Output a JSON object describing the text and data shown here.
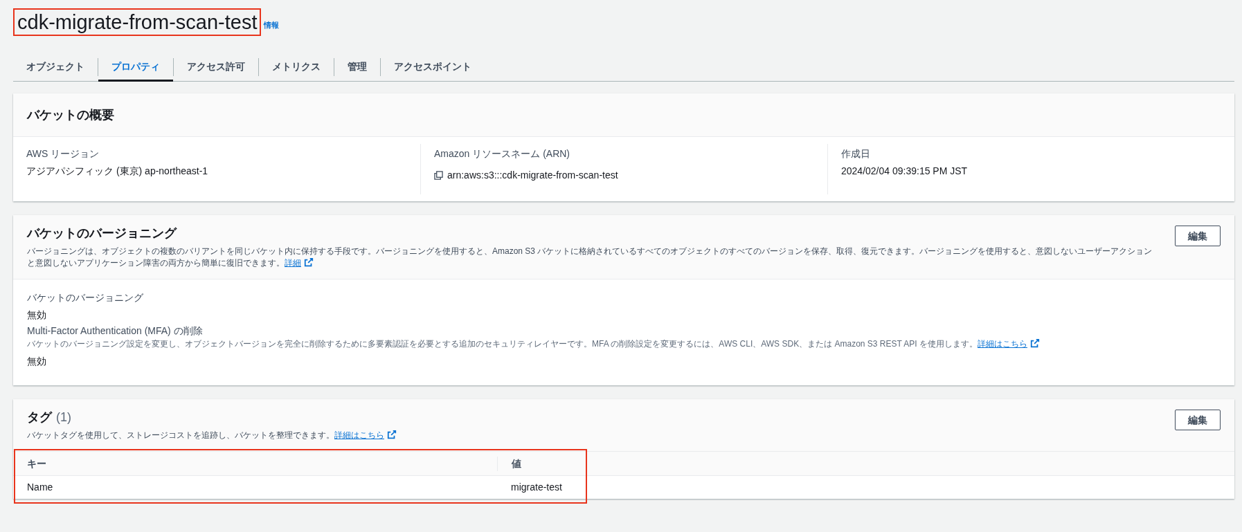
{
  "header": {
    "title": "cdk-migrate-from-scan-test",
    "info_link": "情報",
    "highlighted": true
  },
  "tabs": [
    {
      "label": "オブジェクト",
      "selected": false
    },
    {
      "label": "プロパティ",
      "selected": true
    },
    {
      "label": "アクセス許可",
      "selected": false
    },
    {
      "label": "メトリクス",
      "selected": false
    },
    {
      "label": "管理",
      "selected": false
    },
    {
      "label": "アクセスポイント",
      "selected": false
    }
  ],
  "overview": {
    "title": "バケットの概要",
    "fields": [
      {
        "label": "AWS リージョン",
        "value": "アジアパシフィック (東京) ap-northeast-1",
        "copyable": false
      },
      {
        "label": "Amazon リソースネーム (ARN)",
        "value": "arn:aws:s3:::cdk-migrate-from-scan-test",
        "copyable": true
      },
      {
        "label": "作成日",
        "value": "2024/02/04 09:39:15 PM JST",
        "copyable": false
      }
    ]
  },
  "versioning": {
    "title": "バケットのバージョニング",
    "description": "バージョニングは、オブジェクトの複数のバリアントを同じバケット内に保持する手段です。バージョニングを使用すると、Amazon S3 バケットに格納されているすべてのオブジェクトのすべてのバージョンを保存、取得、復元できます。バージョニングを使用すると、意図しないユーザーアクションと意図しないアプリケーション障害の両方から簡単に復旧できます。",
    "link": "詳細",
    "edit_button": "編集",
    "fields": [
      {
        "label": "バケットのバージョニング",
        "value": "無効"
      },
      {
        "label": "Multi-Factor Authentication (MFA) の削除",
        "description": "バケットのバージョニング設定を変更し、オブジェクトバージョンを完全に削除するために多要素認証を必要とする追加のセキュリティレイヤーです。MFA の削除設定を変更するには、AWS CLI、AWS SDK、または Amazon S3 REST API を使用します。",
        "link": "詳細はこちら",
        "value": "無効"
      }
    ]
  },
  "tags": {
    "title": "タグ",
    "count": "(1)",
    "description": "バケットタグを使用して、ストレージコストを追跡し、バケットを整理できます。",
    "link": "詳細はこちら",
    "edit_button": "編集",
    "highlighted": true,
    "columns": [
      "キー",
      "値"
    ],
    "rows": [
      [
        "Name",
        "migrate-test"
      ]
    ]
  }
}
